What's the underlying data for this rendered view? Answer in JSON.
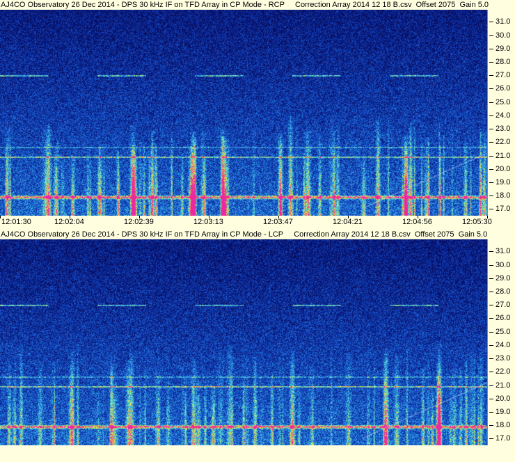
{
  "chart_data": [
    {
      "type": "heatmap",
      "title": "AJ4CO Observatory 26 Dec 2014 - DPS 30 kHz IF on TFD Array in CP Mode - RCP     Correction Array 2014 12 18 B.csv  Offset 2075  Gain 5.0",
      "ylabel": "",
      "xlabel": "",
      "y_ticks": [
        "31.0",
        "30.0",
        "29.0",
        "28.0",
        "27.0",
        "26.0",
        "25.0",
        "24.0",
        "23.0",
        "22.0",
        "21.0",
        "20.0",
        "19.0",
        "18.0",
        "17.0"
      ],
      "y_values": [
        31,
        30,
        29,
        28,
        27,
        26,
        25,
        24,
        23,
        22,
        21,
        20,
        19,
        18,
        17
      ],
      "ylim": [
        16.5,
        31.9
      ],
      "x_ticks": [
        "12:01:30",
        "12:02:04",
        "12:02:39",
        "12:03:13",
        "12:03:47",
        "12:04:21",
        "12:04:56",
        "12:05:30"
      ],
      "grid": false
    },
    {
      "type": "heatmap",
      "title": "AJ4CO Observatory 26 Dec 2014 - DPS 30 kHz IF on TFD Array in CP Mode - LCP     Correction Array 2014 12 18 B.csv  Offset 2075  Gain 5.0",
      "ylabel": "",
      "xlabel": "",
      "y_ticks": [
        "31.0",
        "30.0",
        "29.0",
        "28.0",
        "27.0",
        "26.0",
        "25.0",
        "24.0",
        "23.0",
        "22.0",
        "21.0",
        "20.0",
        "19.0",
        "18.0",
        "17.0"
      ],
      "y_values": [
        31,
        30,
        29,
        28,
        27,
        26,
        25,
        24,
        23,
        22,
        21,
        20,
        19,
        18,
        17
      ],
      "ylim": [
        16.5,
        31.9
      ],
      "x_ticks": [],
      "grid": false
    }
  ]
}
